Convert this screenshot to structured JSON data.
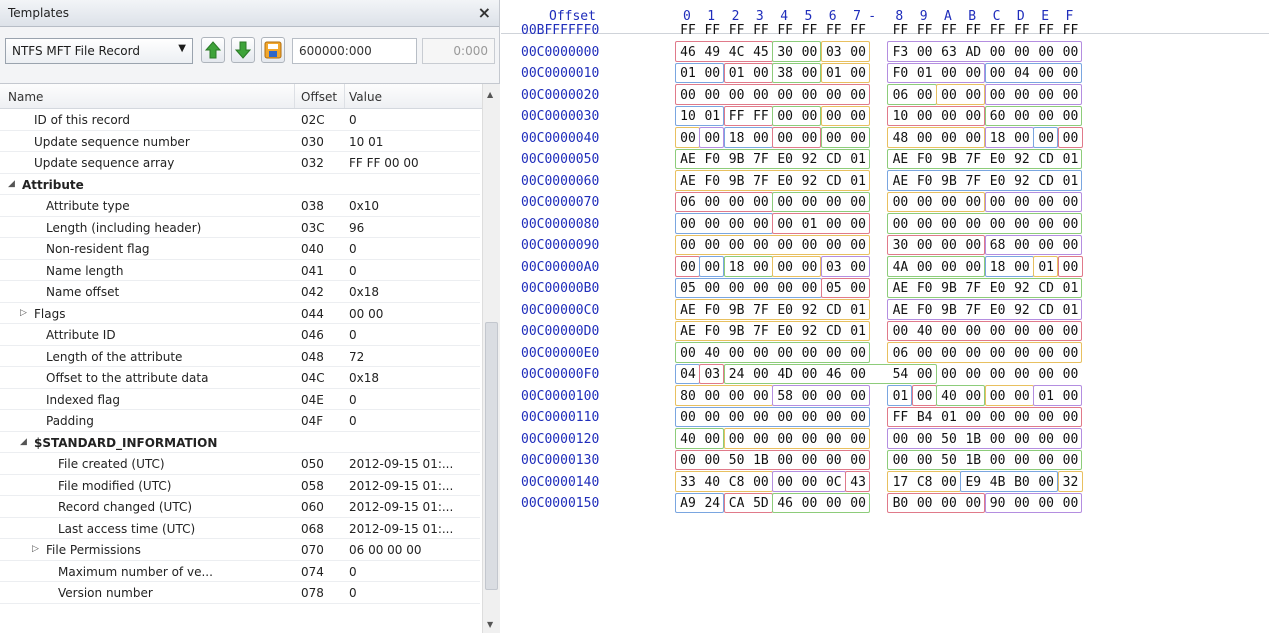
{
  "left_panel": {
    "title": "Templates",
    "close_label": "×",
    "template_select": "NTFS MFT File Record",
    "address_start": "600000:000",
    "address_length": "0:000",
    "columns": {
      "name": "Name",
      "offset": "Offset",
      "value": "Value"
    },
    "rows": [
      {
        "indent": 1,
        "twisty": "",
        "bold": false,
        "name": "ID of this record",
        "offset": "02C",
        "value": "0"
      },
      {
        "indent": 1,
        "twisty": "",
        "bold": false,
        "name": "Update sequence number",
        "offset": "030",
        "value": "10 01"
      },
      {
        "indent": 1,
        "twisty": "",
        "bold": false,
        "name": "Update sequence array",
        "offset": "032",
        "value": "FF FF 00 00"
      },
      {
        "indent": 0,
        "twisty": "◢",
        "bold": true,
        "name": "Attribute",
        "offset": "",
        "value": ""
      },
      {
        "indent": 2,
        "twisty": "",
        "bold": false,
        "name": "Attribute type",
        "offset": "038",
        "value": "0x10"
      },
      {
        "indent": 2,
        "twisty": "",
        "bold": false,
        "name": "Length (including header)",
        "offset": "03C",
        "value": "96"
      },
      {
        "indent": 2,
        "twisty": "",
        "bold": false,
        "name": "Non-resident flag",
        "offset": "040",
        "value": "0"
      },
      {
        "indent": 2,
        "twisty": "",
        "bold": false,
        "name": "Name length",
        "offset": "041",
        "value": "0"
      },
      {
        "indent": 2,
        "twisty": "",
        "bold": false,
        "name": "Name offset",
        "offset": "042",
        "value": "0x18"
      },
      {
        "indent": 1,
        "twisty": "▷",
        "bold": false,
        "name": "Flags",
        "offset": "044",
        "value": "00 00"
      },
      {
        "indent": 2,
        "twisty": "",
        "bold": false,
        "name": "Attribute ID",
        "offset": "046",
        "value": "0"
      },
      {
        "indent": 2,
        "twisty": "",
        "bold": false,
        "name": "Length of the attribute",
        "offset": "048",
        "value": "72"
      },
      {
        "indent": 2,
        "twisty": "",
        "bold": false,
        "name": "Offset to the attribute data",
        "offset": "04C",
        "value": "0x18"
      },
      {
        "indent": 2,
        "twisty": "",
        "bold": false,
        "name": "Indexed flag",
        "offset": "04E",
        "value": "0"
      },
      {
        "indent": 2,
        "twisty": "",
        "bold": false,
        "name": "Padding",
        "offset": "04F",
        "value": "0"
      },
      {
        "indent": 1,
        "twisty": "◢",
        "bold": true,
        "name": "$STANDARD_INFORMATION",
        "offset": "",
        "value": ""
      },
      {
        "indent": 3,
        "twisty": "",
        "bold": false,
        "name": "File created (UTC)",
        "offset": "050",
        "value": "2012-09-15 01:..."
      },
      {
        "indent": 3,
        "twisty": "",
        "bold": false,
        "name": "File modified (UTC)",
        "offset": "058",
        "value": "2012-09-15 01:..."
      },
      {
        "indent": 3,
        "twisty": "",
        "bold": false,
        "name": "Record changed (UTC)",
        "offset": "060",
        "value": "2012-09-15 01:..."
      },
      {
        "indent": 3,
        "twisty": "",
        "bold": false,
        "name": "Last access time (UTC)",
        "offset": "068",
        "value": "2012-09-15 01:..."
      },
      {
        "indent": 2,
        "twisty": "▷",
        "bold": false,
        "name": "File Permissions",
        "offset": "070",
        "value": "06 00 00 00"
      },
      {
        "indent": 3,
        "twisty": "",
        "bold": false,
        "name": "Maximum number of ve...",
        "offset": "074",
        "value": "0"
      },
      {
        "indent": 3,
        "twisty": "",
        "bold": false,
        "name": "Version number",
        "offset": "078",
        "value": "0"
      }
    ]
  },
  "hex_view": {
    "offset_header": "Offset",
    "column_headers": [
      "0",
      "1",
      "2",
      "3",
      "4",
      "5",
      "6",
      "7",
      "-",
      "8",
      "9",
      "A",
      "B",
      "C",
      "D",
      "E",
      "F"
    ],
    "rows": [
      {
        "addr": "00BFFFFFF0",
        "bytes": [
          "FF",
          "FF",
          "FF",
          "FF",
          "FF",
          "FF",
          "FF",
          "FF",
          "FF",
          "FF",
          "FF",
          "FF",
          "FF",
          "FF",
          "FF",
          "FF"
        ]
      },
      {
        "addr": "00C0000000",
        "bytes": [
          "46",
          "49",
          "4C",
          "45",
          "30",
          "00",
          "03",
          "00",
          "F3",
          "00",
          "63",
          "AD",
          "00",
          "00",
          "00",
          "00"
        ]
      },
      {
        "addr": "00C0000010",
        "bytes": [
          "01",
          "00",
          "01",
          "00",
          "38",
          "00",
          "01",
          "00",
          "F0",
          "01",
          "00",
          "00",
          "00",
          "04",
          "00",
          "00"
        ]
      },
      {
        "addr": "00C0000020",
        "bytes": [
          "00",
          "00",
          "00",
          "00",
          "00",
          "00",
          "00",
          "00",
          "06",
          "00",
          "00",
          "00",
          "00",
          "00",
          "00",
          "00"
        ]
      },
      {
        "addr": "00C0000030",
        "bytes": [
          "10",
          "01",
          "FF",
          "FF",
          "00",
          "00",
          "00",
          "00",
          "10",
          "00",
          "00",
          "00",
          "60",
          "00",
          "00",
          "00"
        ]
      },
      {
        "addr": "00C0000040",
        "bytes": [
          "00",
          "00",
          "18",
          "00",
          "00",
          "00",
          "00",
          "00",
          "48",
          "00",
          "00",
          "00",
          "18",
          "00",
          "00",
          "00"
        ]
      },
      {
        "addr": "00C0000050",
        "bytes": [
          "AE",
          "F0",
          "9B",
          "7F",
          "E0",
          "92",
          "CD",
          "01",
          "AE",
          "F0",
          "9B",
          "7F",
          "E0",
          "92",
          "CD",
          "01"
        ]
      },
      {
        "addr": "00C0000060",
        "bytes": [
          "AE",
          "F0",
          "9B",
          "7F",
          "E0",
          "92",
          "CD",
          "01",
          "AE",
          "F0",
          "9B",
          "7F",
          "E0",
          "92",
          "CD",
          "01"
        ]
      },
      {
        "addr": "00C0000070",
        "bytes": [
          "06",
          "00",
          "00",
          "00",
          "00",
          "00",
          "00",
          "00",
          "00",
          "00",
          "00",
          "00",
          "00",
          "00",
          "00",
          "00"
        ]
      },
      {
        "addr": "00C0000080",
        "bytes": [
          "00",
          "00",
          "00",
          "00",
          "00",
          "01",
          "00",
          "00",
          "00",
          "00",
          "00",
          "00",
          "00",
          "00",
          "00",
          "00"
        ]
      },
      {
        "addr": "00C0000090",
        "bytes": [
          "00",
          "00",
          "00",
          "00",
          "00",
          "00",
          "00",
          "00",
          "30",
          "00",
          "00",
          "00",
          "68",
          "00",
          "00",
          "00"
        ]
      },
      {
        "addr": "00C00000A0",
        "bytes": [
          "00",
          "00",
          "18",
          "00",
          "00",
          "00",
          "03",
          "00",
          "4A",
          "00",
          "00",
          "00",
          "18",
          "00",
          "01",
          "00"
        ]
      },
      {
        "addr": "00C00000B0",
        "bytes": [
          "05",
          "00",
          "00",
          "00",
          "00",
          "00",
          "05",
          "00",
          "AE",
          "F0",
          "9B",
          "7F",
          "E0",
          "92",
          "CD",
          "01"
        ]
      },
      {
        "addr": "00C00000C0",
        "bytes": [
          "AE",
          "F0",
          "9B",
          "7F",
          "E0",
          "92",
          "CD",
          "01",
          "AE",
          "F0",
          "9B",
          "7F",
          "E0",
          "92",
          "CD",
          "01"
        ]
      },
      {
        "addr": "00C00000D0",
        "bytes": [
          "AE",
          "F0",
          "9B",
          "7F",
          "E0",
          "92",
          "CD",
          "01",
          "00",
          "40",
          "00",
          "00",
          "00",
          "00",
          "00",
          "00"
        ]
      },
      {
        "addr": "00C00000E0",
        "bytes": [
          "00",
          "40",
          "00",
          "00",
          "00",
          "00",
          "00",
          "00",
          "06",
          "00",
          "00",
          "00",
          "00",
          "00",
          "00",
          "00"
        ]
      },
      {
        "addr": "00C00000F0",
        "bytes": [
          "04",
          "03",
          "24",
          "00",
          "4D",
          "00",
          "46",
          "00",
          "54",
          "00",
          "00",
          "00",
          "00",
          "00",
          "00",
          "00"
        ]
      },
      {
        "addr": "00C0000100",
        "bytes": [
          "80",
          "00",
          "00",
          "00",
          "58",
          "00",
          "00",
          "00",
          "01",
          "00",
          "40",
          "00",
          "00",
          "00",
          "01",
          "00"
        ]
      },
      {
        "addr": "00C0000110",
        "bytes": [
          "00",
          "00",
          "00",
          "00",
          "00",
          "00",
          "00",
          "00",
          "FF",
          "B4",
          "01",
          "00",
          "00",
          "00",
          "00",
          "00"
        ]
      },
      {
        "addr": "00C0000120",
        "bytes": [
          "40",
          "00",
          "00",
          "00",
          "00",
          "00",
          "00",
          "00",
          "00",
          "00",
          "50",
          "1B",
          "00",
          "00",
          "00",
          "00"
        ]
      },
      {
        "addr": "00C0000130",
        "bytes": [
          "00",
          "00",
          "50",
          "1B",
          "00",
          "00",
          "00",
          "00",
          "00",
          "00",
          "50",
          "1B",
          "00",
          "00",
          "00",
          "00"
        ]
      },
      {
        "addr": "00C0000140",
        "bytes": [
          "33",
          "40",
          "C8",
          "00",
          "00",
          "00",
          "0C",
          "43",
          "17",
          "C8",
          "00",
          "E9",
          "4B",
          "B0",
          "00",
          "32"
        ]
      },
      {
        "addr": "00C0000150",
        "bytes": [
          "A9",
          "24",
          "CA",
          "5D",
          "46",
          "00",
          "00",
          "00",
          "B0",
          "00",
          "00",
          "00",
          "90",
          "00",
          "00",
          "00"
        ]
      }
    ],
    "field_boxes": [
      [
        1,
        0,
        3,
        "#e07a8a"
      ],
      [
        1,
        4,
        5,
        "#8dcc7a"
      ],
      [
        1,
        6,
        7,
        "#e8c060"
      ],
      [
        1,
        8,
        15,
        "#b48ee0"
      ],
      [
        2,
        0,
        1,
        "#7aa6e0"
      ],
      [
        2,
        2,
        3,
        "#e07a8a"
      ],
      [
        2,
        4,
        5,
        "#8dcc7a"
      ],
      [
        2,
        6,
        7,
        "#e8c060"
      ],
      [
        2,
        8,
        11,
        "#b48ee0"
      ],
      [
        2,
        12,
        15,
        "#7aa6e0"
      ],
      [
        3,
        0,
        7,
        "#e07a8a"
      ],
      [
        3,
        8,
        9,
        "#8dcc7a"
      ],
      [
        3,
        10,
        11,
        "#e8c060"
      ],
      [
        3,
        12,
        15,
        "#b48ee0"
      ],
      [
        4,
        0,
        1,
        "#7aa6e0"
      ],
      [
        4,
        2,
        3,
        "#e07a8a"
      ],
      [
        4,
        4,
        5,
        "#8dcc7a"
      ],
      [
        4,
        6,
        7,
        "#e8c060"
      ],
      [
        4,
        8,
        11,
        "#e07a8a"
      ],
      [
        4,
        12,
        15,
        "#8dcc7a"
      ],
      [
        5,
        0,
        0,
        "#e8c060"
      ],
      [
        5,
        1,
        1,
        "#b48ee0"
      ],
      [
        5,
        2,
        3,
        "#7aa6e0"
      ],
      [
        5,
        4,
        5,
        "#e07a8a"
      ],
      [
        5,
        6,
        7,
        "#8dcc7a"
      ],
      [
        5,
        8,
        11,
        "#e8c060"
      ],
      [
        5,
        12,
        13,
        "#b48ee0"
      ],
      [
        5,
        14,
        14,
        "#7aa6e0"
      ],
      [
        5,
        15,
        15,
        "#e07a8a"
      ],
      [
        6,
        0,
        7,
        "#8dcc7a"
      ],
      [
        6,
        8,
        15,
        "#8dcc7a"
      ],
      [
        7,
        0,
        7,
        "#e8c060"
      ],
      [
        7,
        8,
        15,
        "#7aa6e0"
      ],
      [
        8,
        0,
        3,
        "#e07a8a"
      ],
      [
        8,
        4,
        7,
        "#8dcc7a"
      ],
      [
        8,
        8,
        11,
        "#e8c060"
      ],
      [
        8,
        12,
        15,
        "#b48ee0"
      ],
      [
        9,
        0,
        3,
        "#7aa6e0"
      ],
      [
        9,
        4,
        7,
        "#e07a8a"
      ],
      [
        9,
        8,
        15,
        "#8dcc7a"
      ],
      [
        10,
        0,
        7,
        "#e8c060"
      ],
      [
        10,
        8,
        11,
        "#e07a8a"
      ],
      [
        10,
        12,
        15,
        "#b48ee0"
      ],
      [
        11,
        0,
        0,
        "#e07a8a"
      ],
      [
        11,
        1,
        1,
        "#7aa6e0"
      ],
      [
        11,
        2,
        3,
        "#8dcc7a"
      ],
      [
        11,
        4,
        5,
        "#e8c060"
      ],
      [
        11,
        6,
        7,
        "#b48ee0"
      ],
      [
        11,
        8,
        11,
        "#8dcc7a"
      ],
      [
        11,
        12,
        13,
        "#7aa6e0"
      ],
      [
        11,
        14,
        14,
        "#e8c060"
      ],
      [
        11,
        15,
        15,
        "#e07a8a"
      ],
      [
        12,
        0,
        5,
        "#7aa6e0"
      ],
      [
        12,
        6,
        7,
        "#e07a8a"
      ],
      [
        12,
        8,
        15,
        "#8dcc7a"
      ],
      [
        13,
        0,
        7,
        "#e8c060"
      ],
      [
        13,
        8,
        15,
        "#b48ee0"
      ],
      [
        14,
        0,
        7,
        "#e8c060"
      ],
      [
        14,
        8,
        15,
        "#e07a8a"
      ],
      [
        15,
        0,
        7,
        "#8dcc7a"
      ],
      [
        15,
        8,
        15,
        "#e8c060"
      ],
      [
        16,
        0,
        0,
        "#7aa6e0"
      ],
      [
        16,
        1,
        1,
        "#e07a8a"
      ],
      [
        16,
        2,
        9,
        "#8dcc7a"
      ],
      [
        17,
        0,
        3,
        "#e8c060"
      ],
      [
        17,
        4,
        7,
        "#b48ee0"
      ],
      [
        17,
        8,
        8,
        "#7aa6e0"
      ],
      [
        17,
        9,
        9,
        "#e07a8a"
      ],
      [
        17,
        10,
        11,
        "#8dcc7a"
      ],
      [
        17,
        12,
        13,
        "#e8c060"
      ],
      [
        17,
        14,
        15,
        "#b48ee0"
      ],
      [
        18,
        0,
        7,
        "#7aa6e0"
      ],
      [
        18,
        8,
        15,
        "#e07a8a"
      ],
      [
        19,
        0,
        1,
        "#8dcc7a"
      ],
      [
        19,
        2,
        7,
        "#e8c060"
      ],
      [
        19,
        8,
        15,
        "#b48ee0"
      ],
      [
        20,
        0,
        7,
        "#e07a8a"
      ],
      [
        20,
        8,
        15,
        "#8dcc7a"
      ],
      [
        21,
        0,
        3,
        "#e8c060"
      ],
      [
        21,
        4,
        6,
        "#b48ee0"
      ],
      [
        21,
        7,
        7,
        "#e07a8a"
      ],
      [
        21,
        8,
        10,
        "#e8c060"
      ],
      [
        21,
        11,
        14,
        "#7aa6e0"
      ],
      [
        21,
        15,
        15,
        "#e8c060"
      ],
      [
        22,
        0,
        1,
        "#7aa6e0"
      ],
      [
        22,
        2,
        3,
        "#e07a8a"
      ],
      [
        22,
        4,
        7,
        "#8dcc7a"
      ],
      [
        22,
        8,
        11,
        "#e07a8a"
      ],
      [
        22,
        12,
        15,
        "#b48ee0"
      ]
    ]
  }
}
